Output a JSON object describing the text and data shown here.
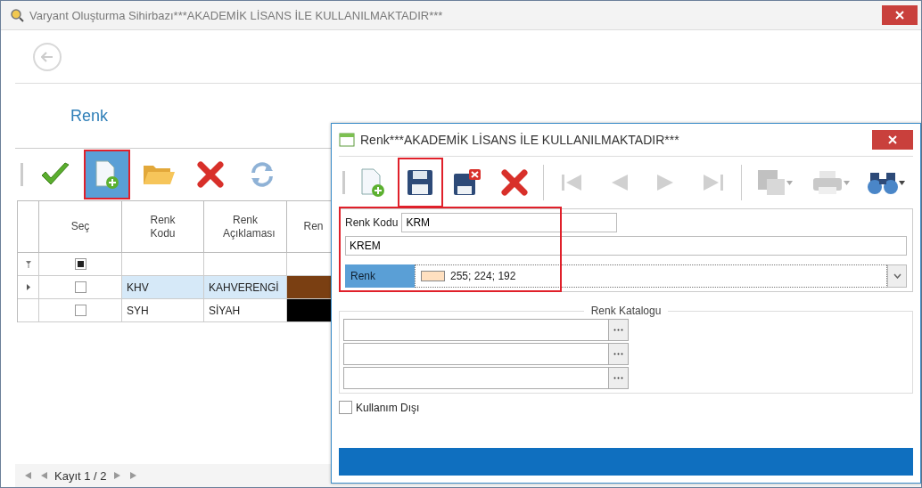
{
  "window": {
    "title": "Varyant Oluşturma Sihirbazı***AKADEMİK LİSANS İLE KULLANILMAKTADIR***"
  },
  "header": {
    "title": "Renk"
  },
  "toolbar": [
    {
      "kind": "approve",
      "pressed": false,
      "highlighted": false
    },
    {
      "kind": "new",
      "pressed": true,
      "highlighted": true
    },
    {
      "kind": "open",
      "pressed": false,
      "highlighted": false
    },
    {
      "kind": "delete",
      "pressed": false,
      "highlighted": false
    },
    {
      "kind": "refresh",
      "pressed": false,
      "highlighted": false
    }
  ],
  "grid": {
    "columns": [
      "Seç",
      "Renk Kodu",
      "Renk Açıklaması",
      "Ren"
    ],
    "filter_row": {
      "indeterminate": true
    },
    "rows": [
      {
        "selected": true,
        "checked": false,
        "code": "KHV",
        "description": "KAHVERENGİ",
        "color": "#7a3f12"
      },
      {
        "selected": false,
        "checked": false,
        "code": "SYH",
        "description": "SİYAH",
        "color": "#000000"
      }
    ]
  },
  "pager": {
    "text": "Kayıt 1 / 2"
  },
  "dialog": {
    "title": "Renk***AKADEMİK LİSANS İLE KULLANILMAKTADIR***",
    "toolbar": [
      {
        "kind": "new",
        "disabled": false,
        "highlighted": false,
        "dropdown": false
      },
      {
        "kind": "save",
        "disabled": false,
        "highlighted": true,
        "dropdown": false
      },
      {
        "kind": "save-close",
        "disabled": false,
        "highlighted": false,
        "dropdown": false
      },
      {
        "kind": "delete",
        "disabled": false,
        "highlighted": false,
        "dropdown": false
      },
      {
        "kind": "separator"
      },
      {
        "kind": "first",
        "disabled": true,
        "highlighted": false,
        "dropdown": false
      },
      {
        "kind": "previous",
        "disabled": true,
        "highlighted": false,
        "dropdown": false
      },
      {
        "kind": "next",
        "disabled": true,
        "highlighted": false,
        "dropdown": false
      },
      {
        "kind": "last",
        "disabled": true,
        "highlighted": false,
        "dropdown": false
      },
      {
        "kind": "separator"
      },
      {
        "kind": "save-as",
        "disabled": true,
        "highlighted": false,
        "dropdown": true
      },
      {
        "kind": "print",
        "disabled": true,
        "highlighted": false,
        "dropdown": true
      },
      {
        "kind": "find",
        "disabled": false,
        "highlighted": false,
        "dropdown": true
      }
    ],
    "form": {
      "highlighted": true,
      "code_label": "Renk Kodu",
      "code_value": "KRM",
      "description_value": "KREM",
      "color_label": "Renk",
      "color_value": "255; 224; 192",
      "color": "#ffe0c0"
    },
    "catalog": {
      "title": "Renk Katalogu",
      "fields": [
        {
          "kind": "lookup"
        },
        {
          "kind": "lookup"
        },
        {
          "kind": "lookup"
        }
      ]
    },
    "inactive": {
      "label": "Kullanım Dışı",
      "checked": false
    }
  }
}
